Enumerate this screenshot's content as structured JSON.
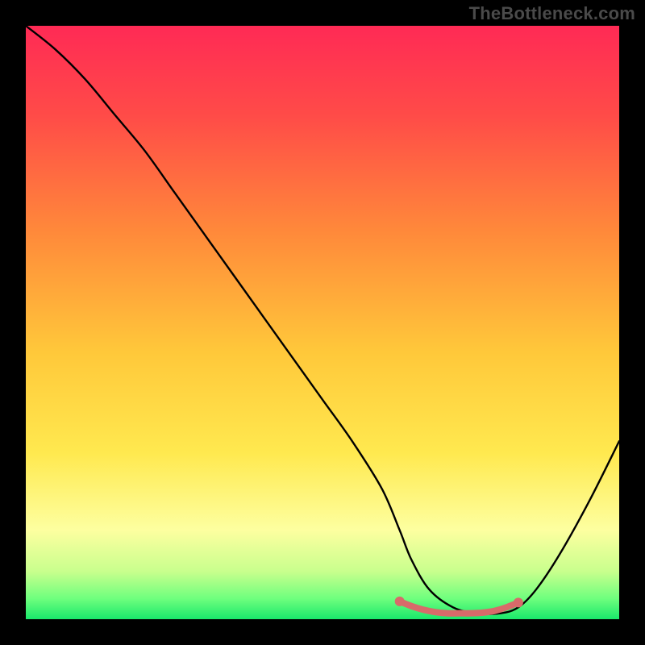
{
  "watermark": "TheBottleneck.com",
  "chart_data": {
    "type": "line",
    "title": "",
    "xlabel": "",
    "ylabel": "",
    "xlim": [
      0,
      100
    ],
    "ylim": [
      0,
      100
    ],
    "grid": false,
    "legend": false,
    "curve": {
      "name": "bottleneck-curve",
      "x": [
        0,
        5,
        10,
        15,
        20,
        25,
        30,
        35,
        40,
        45,
        50,
        55,
        60,
        63,
        65,
        68,
        72,
        76,
        80,
        83,
        86,
        90,
        95,
        100
      ],
      "y": [
        100,
        96,
        91,
        85,
        79,
        72,
        65,
        58,
        51,
        44,
        37,
        30,
        22,
        15,
        10,
        5,
        2,
        1,
        1,
        2,
        5,
        11,
        20,
        30
      ]
    },
    "flat_marker": {
      "name": "optimal-range",
      "color": "#d86a6a",
      "points_x": [
        63,
        65,
        67,
        69,
        71,
        73,
        75,
        77,
        79,
        81,
        83
      ],
      "points_y": [
        3,
        2.2,
        1.6,
        1.2,
        1.0,
        1.0,
        1.0,
        1.1,
        1.4,
        2.0,
        2.8
      ]
    },
    "background_gradient": {
      "stops": [
        {
          "offset": 0.0,
          "color": "#ff2a55"
        },
        {
          "offset": 0.15,
          "color": "#ff4b48"
        },
        {
          "offset": 0.35,
          "color": "#ff8a3a"
        },
        {
          "offset": 0.55,
          "color": "#ffc83a"
        },
        {
          "offset": 0.72,
          "color": "#ffe94f"
        },
        {
          "offset": 0.85,
          "color": "#fdffa0"
        },
        {
          "offset": 0.92,
          "color": "#c8ff8d"
        },
        {
          "offset": 0.965,
          "color": "#6fff7e"
        },
        {
          "offset": 1.0,
          "color": "#19e86b"
        }
      ]
    }
  }
}
